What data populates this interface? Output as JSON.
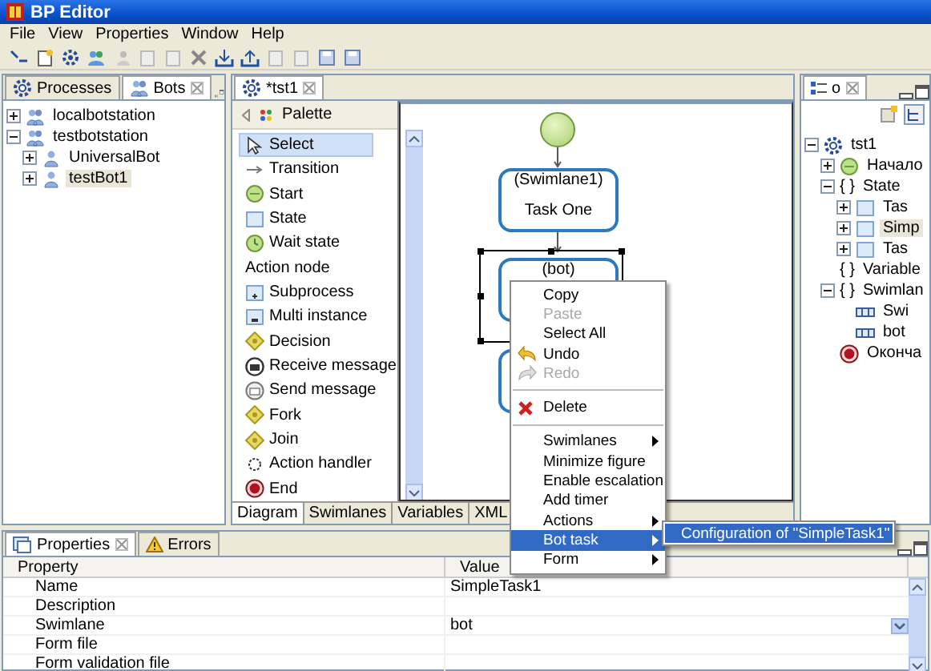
{
  "window": {
    "title": "BP Editor"
  },
  "menu": [
    "File",
    "View",
    "Properties",
    "Window",
    "Help"
  ],
  "left_panel": {
    "tabs": [
      {
        "label": "Processes",
        "selected": false
      },
      {
        "label": "Bots",
        "selected": true
      }
    ],
    "tree": [
      {
        "label": "localbotstation",
        "kind": "station",
        "expanded": false,
        "selected": false
      },
      {
        "label": "testbotstation",
        "kind": "station",
        "expanded": true,
        "selected": false,
        "children": [
          {
            "label": "UniversalBot",
            "kind": "bot",
            "expanded": false,
            "selected": false
          },
          {
            "label": "testBot1",
            "kind": "bot",
            "expanded": false,
            "selected": true
          }
        ]
      }
    ]
  },
  "editor": {
    "tab": "*tst1",
    "palette_title": "Palette",
    "palette": [
      {
        "label": "Select",
        "kind": "select",
        "selected": true
      },
      {
        "label": "Transition",
        "kind": "transition",
        "selected": false
      },
      {
        "label": "Start",
        "kind": "start",
        "selected": false
      },
      {
        "label": "State",
        "kind": "state",
        "selected": false
      },
      {
        "label": "Wait state",
        "kind": "wait",
        "selected": false
      },
      {
        "label": "Action node",
        "kind": "label",
        "selected": false
      },
      {
        "label": "Subprocess",
        "kind": "subprocess",
        "selected": false
      },
      {
        "label": "Multi instance",
        "kind": "multi",
        "selected": false
      },
      {
        "label": "Decision",
        "kind": "decision",
        "selected": false
      },
      {
        "label": "Receive message",
        "kind": "receive",
        "selected": false
      },
      {
        "label": "Send message",
        "kind": "send",
        "selected": false
      },
      {
        "label": "Fork",
        "kind": "fork",
        "selected": false
      },
      {
        "label": "Join",
        "kind": "join",
        "selected": false
      },
      {
        "label": "Action handler",
        "kind": "handler",
        "selected": false
      },
      {
        "label": "End",
        "kind": "end",
        "selected": false
      }
    ],
    "diagram": [
      {
        "kind": "start"
      },
      {
        "kind": "task",
        "lane": "(Swimlane1)",
        "name": "Task One",
        "selected": false
      },
      {
        "kind": "task",
        "lane": "(bot)",
        "selected": true
      },
      {
        "kind": "task",
        "selected": false
      }
    ],
    "bottom_tabs": [
      {
        "label": "Diagram",
        "selected": true
      },
      {
        "label": "Swimlanes",
        "selected": false
      },
      {
        "label": "Variables",
        "selected": false
      },
      {
        "label": "XML",
        "selected": false
      }
    ]
  },
  "context_menu": {
    "items": [
      {
        "label": "Copy",
        "kind": "plain",
        "disabled": false,
        "submenu": false,
        "selected": false
      },
      {
        "label": "Paste",
        "kind": "plain",
        "disabled": true,
        "submenu": false,
        "selected": false
      },
      {
        "label": "Select All",
        "kind": "plain",
        "disabled": false,
        "submenu": false,
        "selected": false
      },
      {
        "label": "Undo",
        "kind": "undo",
        "disabled": false,
        "submenu": false,
        "selected": false
      },
      {
        "label": "Redo",
        "kind": "redo",
        "disabled": true,
        "submenu": false,
        "selected": false
      },
      {
        "kind": "separator"
      },
      {
        "label": "Delete",
        "kind": "delete",
        "disabled": false,
        "submenu": false,
        "selected": false
      },
      {
        "kind": "separator"
      },
      {
        "label": "Swimlanes",
        "kind": "plain",
        "disabled": false,
        "submenu": true,
        "selected": false
      },
      {
        "label": "Minimize figure",
        "kind": "plain",
        "disabled": false,
        "submenu": false,
        "selected": false
      },
      {
        "label": "Enable escalation",
        "kind": "plain",
        "disabled": false,
        "submenu": false,
        "selected": false
      },
      {
        "label": "Add timer",
        "kind": "plain",
        "disabled": false,
        "submenu": false,
        "selected": false
      },
      {
        "label": "Actions",
        "kind": "plain",
        "disabled": false,
        "submenu": true,
        "selected": false
      },
      {
        "label": "Bot task",
        "kind": "plain",
        "disabled": false,
        "submenu": true,
        "selected": true
      },
      {
        "label": "Form",
        "kind": "plain",
        "disabled": false,
        "submenu": true,
        "selected": false
      }
    ],
    "submenu": [
      {
        "label": "Configuration of \"SimpleTask1\"",
        "selected": true
      }
    ]
  },
  "outline": {
    "tab": "o",
    "tree": [
      {
        "label": "tst1",
        "kind": "process",
        "expanded": true,
        "selected": false,
        "children": [
          {
            "label": "Начало",
            "kind": "start",
            "expanded": false,
            "selected": false
          },
          {
            "label": "State",
            "kind": "group",
            "glyph": "{ }",
            "expanded": true,
            "selected": false,
            "children": [
              {
                "label": "Tas",
                "kind": "task",
                "expanded": false,
                "selected": false
              },
              {
                "label": "Simp",
                "kind": "task",
                "expanded": false,
                "selected": true
              },
              {
                "label": "Tas",
                "kind": "task",
                "expanded": false,
                "selected": false
              }
            ]
          },
          {
            "label": "Variable",
            "kind": "group",
            "glyph": "{ }",
            "selected": false
          },
          {
            "label": "Swimlan",
            "kind": "group",
            "glyph": "{ }",
            "expanded": true,
            "selected": false,
            "children": [
              {
                "label": "Swi",
                "kind": "lane",
                "selected": false
              },
              {
                "label": "bot",
                "kind": "lane",
                "selected": false
              }
            ]
          },
          {
            "label": "Оконча",
            "kind": "end",
            "selected": false
          }
        ]
      }
    ]
  },
  "properties": {
    "tabs": [
      {
        "label": "Properties",
        "selected": true
      },
      {
        "label": "Errors",
        "selected": false
      }
    ],
    "columns": [
      "Property",
      "Value"
    ],
    "rows": [
      {
        "property": "Name",
        "value": "SimpleTask1",
        "kind": "text"
      },
      {
        "property": "Description",
        "kind": "text"
      },
      {
        "property": "Swimlane",
        "value": "bot",
        "kind": "combo"
      },
      {
        "property": "Form file",
        "kind": "text"
      },
      {
        "property": "Form validation file",
        "kind": "text"
      }
    ]
  }
}
